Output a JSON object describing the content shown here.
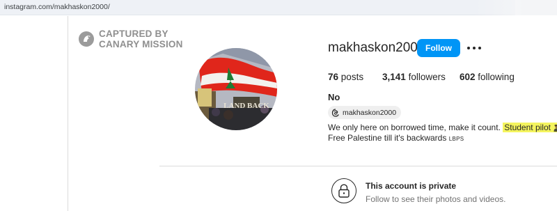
{
  "browser": {
    "url": "instagram.com/makhaskon2000/"
  },
  "watermark": {
    "line1": "CAPTURED BY",
    "line2": "CANARY MISSION"
  },
  "profile": {
    "username": "makhaskon2000",
    "follow_label": "Follow",
    "stats": {
      "posts_count": "76",
      "posts_label": "posts",
      "followers_count": "3,141",
      "followers_label": "followers",
      "following_count": "602",
      "following_label": "following"
    },
    "full_name": "No",
    "threads_handle": "makhaskon2000",
    "bio": {
      "line1_text": "We only here on borrowed time, make it count.",
      "line1_highlight": "Student pilot",
      "line2_text": "Free Palestine till it's backwards",
      "line2_suffix": "LBPS"
    },
    "avatar_sign_text": "LAND BACK"
  },
  "private_notice": {
    "title": "This account is private",
    "subtitle": "Follow to see their photos and videos."
  },
  "colors": {
    "follow_button": "#0095f6",
    "highlight": "#f4f45e",
    "text_primary": "#262626",
    "text_secondary": "#737373"
  },
  "icons": [
    "canary-logo-icon",
    "more-options-icon",
    "threads-icon",
    "pilot-emoji-icon",
    "airplane-emoji-icon",
    "lock-icon"
  ]
}
